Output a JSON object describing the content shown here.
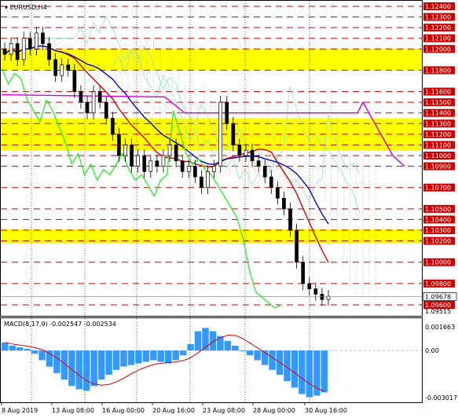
{
  "symbol_title": "EURUSD,H4",
  "macd_title": "MACD(8,17,9) -0.002547 -0.002534",
  "colors": {
    "background": "#ffffff",
    "frame": "#000000",
    "grid": "#000000",
    "level": "#cc0000",
    "yellow_zone": "#ffff00",
    "candle": "#000000",
    "price_tag": "#cc0000",
    "current_tag": "#ffffff",
    "magenta": "#d400d4",
    "red_line": "#dd0000",
    "blue_line": "#0000cc",
    "green_line": "#33ee33",
    "cloud_dotted": "#e8a080",
    "cloud_thin": "#90e0c0",
    "histogram": "#3399ff",
    "signal": "#dd0000"
  },
  "price_axis": {
    "labels": [
      "1.12400",
      "1.12300",
      "1.12200",
      "1.12100",
      "1.12000",
      "1.11800",
      "1.11600",
      "1.11500",
      "1.11400",
      "1.11300",
      "1.11200",
      "1.11100",
      "1.11000",
      "1.10900",
      "1.10700",
      "1.10500",
      "1.10400",
      "1.10300",
      "1.10200",
      "1.10000",
      "1.09800",
      "1.09600",
      "1.09515"
    ],
    "extra_labels": [
      "1.11970",
      "1.10703",
      "1.09763",
      "1.09678",
      "1.09600"
    ],
    "current_price": "1.09678"
  },
  "macd_axis": {
    "labels": [
      "0.001663",
      "0.00",
      "-0.003017"
    ]
  },
  "time_axis": {
    "labels": [
      "8 Aug 2019",
      "13 Aug 08:00",
      "16 Aug 00:00",
      "20 Aug 16:00",
      "23 Aug 08:00",
      "28 Aug 00:00",
      "30 Aug 16:00"
    ]
  },
  "chart_data": {
    "type": "candlestick",
    "symbol": "EURUSD",
    "timeframe": "H4",
    "ylim": [
      1.0951,
      1.1245
    ],
    "support_resistance_levels": [
      1.124,
      1.123,
      1.122,
      1.121,
      1.12,
      1.118,
      1.116,
      1.115,
      1.114,
      1.113,
      1.112,
      1.111,
      1.11,
      1.109,
      1.107,
      1.105,
      1.104,
      1.103,
      1.102,
      1.1,
      1.098,
      1.096
    ],
    "yellow_zones": [
      [
        1.118,
        1.12
      ],
      [
        1.1105,
        1.1135
      ],
      [
        1.1018,
        1.1031
      ]
    ],
    "close_series_approx": [
      1.1195,
      1.1205,
      1.119,
      1.121,
      1.12,
      1.1215,
      1.1205,
      1.119,
      1.1175,
      1.1185,
      1.118,
      1.116,
      1.115,
      1.114,
      1.116,
      1.115,
      1.1135,
      1.112,
      1.11,
      1.111,
      1.109,
      1.11,
      1.1085,
      1.1095,
      1.109,
      1.11,
      1.111,
      1.1095,
      1.1085,
      1.109,
      1.108,
      1.107,
      1.1085,
      1.109,
      1.115,
      1.113,
      1.111,
      1.11,
      1.1105,
      1.1095,
      1.109,
      1.108,
      1.107,
      1.106,
      1.105,
      1.103,
      1.1,
      1.098,
      1.0975,
      1.097,
      1.0965,
      1.0968
    ],
    "macd_histogram_approx": [
      0.0005,
      0.0003,
      0.0002,
      0.0001,
      -0.0002,
      -0.0006,
      -0.001,
      -0.0014,
      -0.0018,
      -0.0022,
      -0.0024,
      -0.0025,
      -0.0022,
      -0.0018,
      -0.0015,
      -0.0012,
      -0.001,
      -0.0009,
      -0.0008,
      -0.0007,
      -0.0006,
      -0.0007,
      -0.0008,
      -0.0006,
      -0.0003,
      0.0004,
      0.0012,
      0.0014,
      0.0012,
      0.0009,
      0.0006,
      0.0003,
      0.0,
      -0.0003,
      -0.0006,
      -0.0009,
      -0.0012,
      -0.0015,
      -0.0019,
      -0.0023,
      -0.0027,
      -0.0029,
      -0.0028,
      -0.0026
    ],
    "macd_ylim": [
      -0.003017,
      0.001663
    ]
  }
}
